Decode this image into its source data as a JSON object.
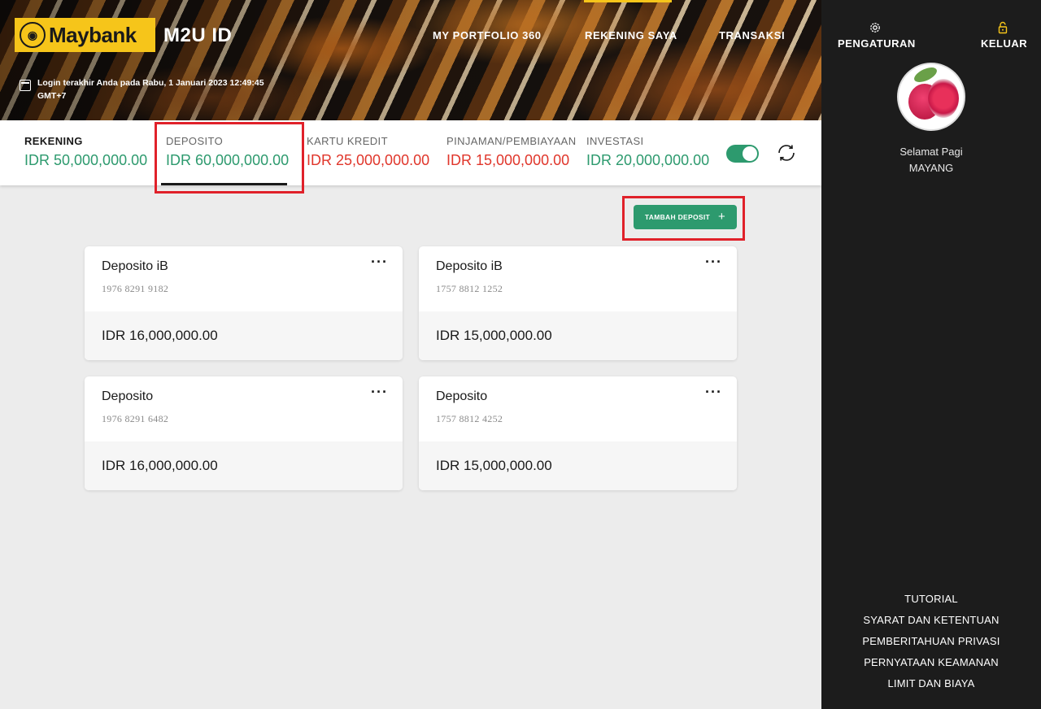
{
  "brand": {
    "logo_text": "Maybank",
    "app_name": "M2U ID"
  },
  "last_login": "Login terakhir Anda pada Rabu, 1 Januari 2023 12:49:45 GMT+7",
  "topnav": [
    {
      "label": "MY PORTFOLIO 360"
    },
    {
      "label": "REKENING SAYA",
      "active": true
    },
    {
      "label": "TRANSAKSI"
    }
  ],
  "sidebar": {
    "settings_label": "PENGATURAN",
    "logout_label": "KELUAR",
    "greeting": "Selamat Pagi",
    "user_name": "MAYANG",
    "links": [
      "TUTORIAL",
      "SYARAT DAN KETENTUAN",
      "PEMBERITAHUAN PRIVASI",
      "PERNYATAAN KEAMANAN",
      "LIMIT DAN BIAYA"
    ]
  },
  "summary": [
    {
      "label": "REKENING",
      "value": "IDR 50,000,000.00",
      "status": "green"
    },
    {
      "label": "DEPOSITO",
      "value": "IDR 60,000,000.00",
      "status": "green",
      "active": true
    },
    {
      "label": "KARTU KREDIT",
      "value": "IDR 25,000,000.00",
      "status": "red"
    },
    {
      "label": "PINJAMAN/PEMBIAYAAN",
      "value": "IDR 15,000,000.00",
      "status": "red"
    },
    {
      "label": "INVESTASI",
      "value": "IDR 20,000,000.00",
      "status": "green"
    }
  ],
  "toggle_on": true,
  "add_deposit_label": "TAMBAH DEPOSIT",
  "cards": [
    {
      "name": "Deposito iB",
      "account": "1976 8291 9182",
      "amount": "IDR 16,000,000.00"
    },
    {
      "name": "Deposito iB",
      "account": "1757 8812 1252",
      "amount": "IDR 15,000,000.00"
    },
    {
      "name": "Deposito",
      "account": "1976 8291 6482",
      "amount": "IDR 16,000,000.00"
    },
    {
      "name": "Deposito",
      "account": "1757 8812 4252",
      "amount": "IDR 15,000,000.00"
    }
  ],
  "colors": {
    "accent_green": "#2d9a6e",
    "negative_red": "#e0362b",
    "brand_yellow": "#f6c51a",
    "highlight_red": "#e0212a",
    "sidebar_bg": "#1c1c1c"
  },
  "icons": [
    "calendar-icon",
    "gear-icon",
    "lock-icon",
    "refresh-icon",
    "plus-icon",
    "more-icon"
  ]
}
